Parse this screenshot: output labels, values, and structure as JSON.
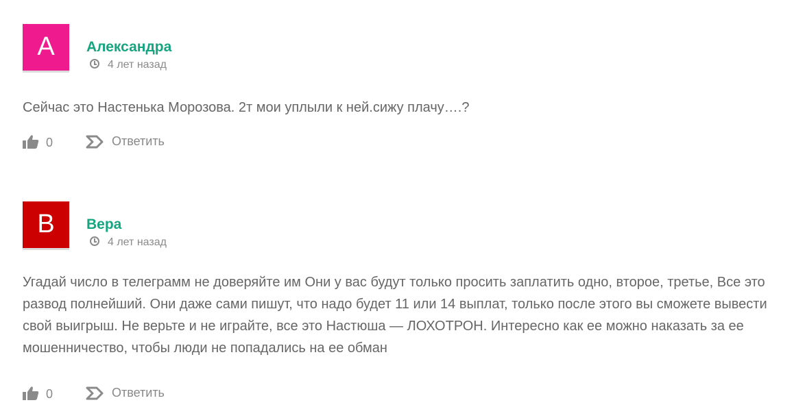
{
  "comments": [
    {
      "avatar_letter": "A",
      "avatar_color": "#ee1a8e",
      "author": "Александра",
      "date": "4 лет назад",
      "text": "Сейчас это Настенька Морозова. 2т мои уплыли к ней.сижу плачу….?",
      "likes": "0",
      "reply_label": "Ответить"
    },
    {
      "avatar_letter": "B",
      "avatar_color": "#cc0000",
      "author": "Вера",
      "date": "4 лет назад",
      "text": "Угадай число в телеграмм не доверяйте им Они у вас будут только просить заплатить одно, второе, третье, Все это развод полнейший. Они даже сами пишут, что надо будет 11 или 14 выплат, только после этого вы сможете вывести свой выигрыш. Не верьте и не играйте, все это Настюша — ЛОХОТРОН. Интересно как ее можно наказать за ее мошенничество, чтобы люди не попадались на ее обман",
      "likes": "0",
      "reply_label": "Ответить"
    }
  ]
}
